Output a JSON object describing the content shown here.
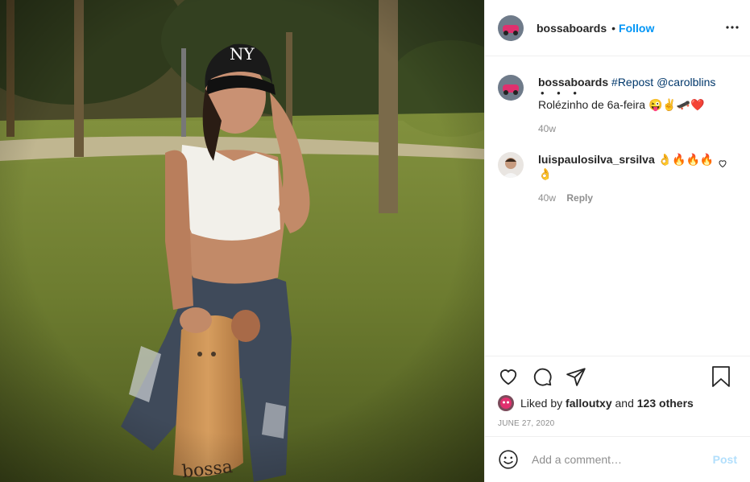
{
  "post": {
    "username": "bossaboards",
    "separator": "•",
    "follow_label": "Follow",
    "more_icon": "more-horizontal-icon",
    "photo_logo_text": "bossa"
  },
  "caption": {
    "username": "bossaboards",
    "hashtag": "#Repost @carolblins",
    "dots": "• • •",
    "text": "Rolézinho de 6a-feira 😜✌️🛹❤️",
    "time": "40w"
  },
  "comments": [
    {
      "username": "luispaulosilva_srsilva",
      "text": "👌🔥🔥🔥👌",
      "time": "40w",
      "reply_label": "Reply"
    }
  ],
  "actions": {
    "like_icon": "heart-icon",
    "comment_icon": "comment-icon",
    "share_icon": "send-icon",
    "save_icon": "bookmark-icon"
  },
  "likes": {
    "prefix": "Liked by",
    "user": "falloutxy",
    "conj": "and",
    "others": "123 others"
  },
  "date": "JUNE 27, 2020",
  "add_comment": {
    "placeholder": "Add a comment…",
    "post_label": "Post"
  },
  "colors": {
    "link_blue": "#0095f6",
    "hashtag": "#00376b",
    "muted": "#8e8e8e",
    "post_disabled": "#b2dffc"
  }
}
